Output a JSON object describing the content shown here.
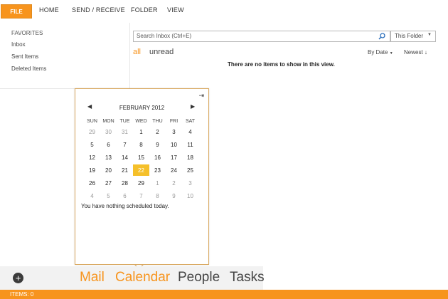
{
  "ribbon": {
    "tabs": [
      "FILE",
      "HOME",
      "SEND / RECEIVE",
      "FOLDER",
      "VIEW"
    ]
  },
  "nav": {
    "favorites_header": "FAVORITES",
    "items": [
      "Inbox",
      "Sent Items",
      "Deleted Items"
    ]
  },
  "search": {
    "placeholder": "Search Inbox (Ctrl+E)",
    "scope": "This Folder"
  },
  "filters": {
    "all": "all",
    "unread": "unread",
    "sort_by": "By Date",
    "sort_order": "Newest"
  },
  "empty_message": "There are no items to show in this view.",
  "calendar": {
    "month": "FEBRUARY 2012",
    "weekdays": [
      "SUN",
      "MON",
      "TUE",
      "WED",
      "THU",
      "FRI",
      "SAT"
    ],
    "weeks": [
      [
        "29",
        "30",
        "31",
        "1",
        "2",
        "3",
        "4"
      ],
      [
        "5",
        "6",
        "7",
        "8",
        "9",
        "10",
        "11"
      ],
      [
        "12",
        "13",
        "14",
        "15",
        "16",
        "17",
        "18"
      ],
      [
        "19",
        "20",
        "21",
        "22",
        "23",
        "24",
        "25"
      ],
      [
        "26",
        "27",
        "28",
        "29",
        "1",
        "2",
        "3"
      ],
      [
        "4",
        "5",
        "6",
        "7",
        "8",
        "9",
        "10"
      ]
    ],
    "selected_day": "22",
    "nothing_scheduled": "You have nothing scheduled today."
  },
  "bottom_nav": [
    "Mail",
    "Calendar",
    "People",
    "Tasks"
  ],
  "status": "ITEMS: 0",
  "colors": {
    "accent": "#f7941d",
    "selected_day": "#f5c02a"
  }
}
